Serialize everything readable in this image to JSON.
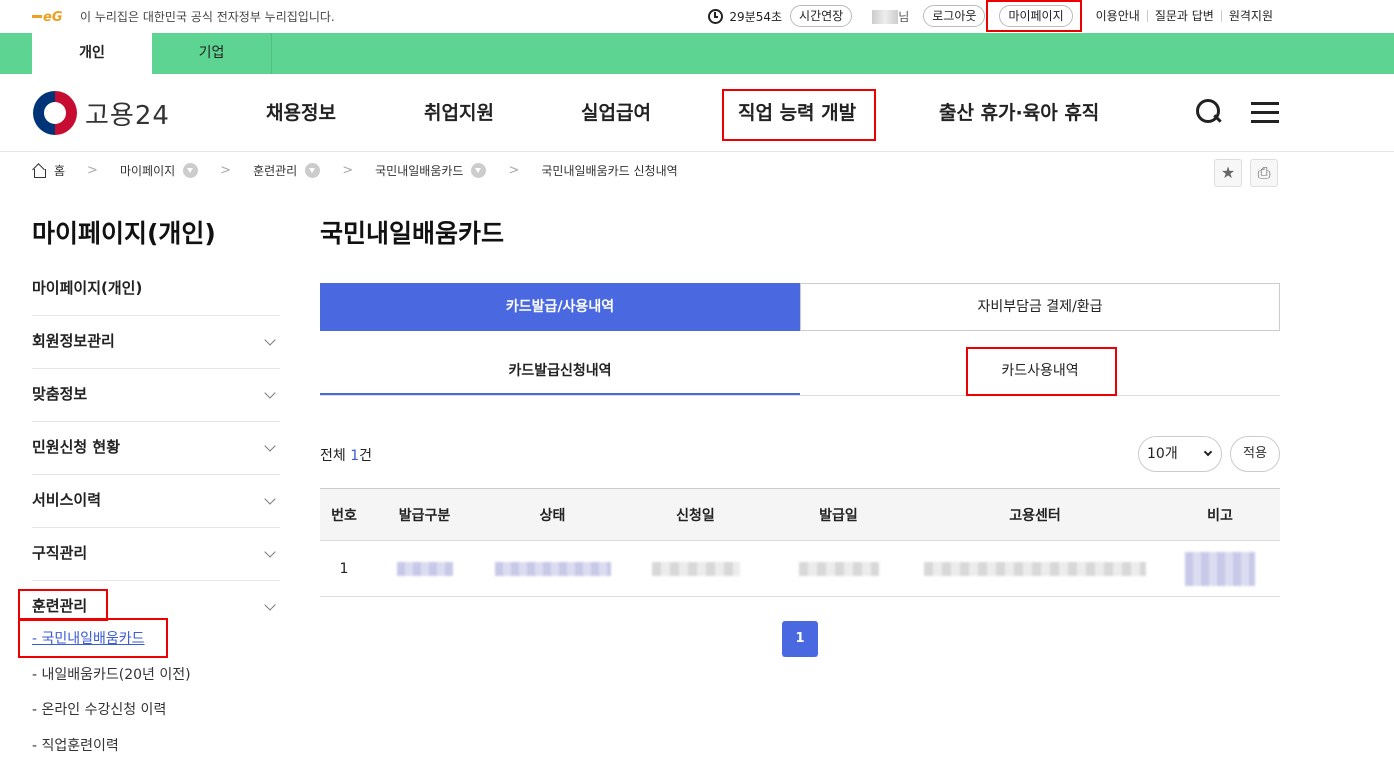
{
  "util": {
    "logo_text": "eG",
    "gov_notice": "이 누리집은 대한민국 공식 전자정부 누리집입니다.",
    "timer": "29분54초",
    "extend_label": "시간연장",
    "user_suffix": "님",
    "logout_label": "로그아웃",
    "mypage_label": "마이페이지",
    "links": [
      "이용안내",
      "질문과 답변",
      "원격지원"
    ]
  },
  "greenbar": {
    "tabs": [
      "개인",
      "기업"
    ]
  },
  "header": {
    "brand": "고용24",
    "nav": [
      "채용정보",
      "취업지원",
      "실업급여",
      "직업 능력 개발",
      "출산 휴가·육아 휴직"
    ]
  },
  "breadcrumb": [
    "홈",
    "마이페이지",
    "훈련관리",
    "국민내일배움카드",
    "국민내일배움카드 신청내역"
  ],
  "lnb": {
    "title": "마이페이지(개인)",
    "items": [
      "마이페이지(개인)",
      "회원정보관리",
      "맞춤정보",
      "민원신청 현황",
      "서비스이력",
      "구직관리",
      "훈련관리"
    ],
    "sub": [
      "- 국민내일배움카드",
      "- 내일배움카드(20년 이전)",
      "- 온라인 수강신청 이력",
      "- 직업훈련이력"
    ]
  },
  "content": {
    "title": "국민내일배움카드",
    "tabs1": [
      "카드발급/사용내역",
      "자비부담금 결제/환급"
    ],
    "tabs2": [
      "카드발급신청내역",
      "카드사용내역"
    ],
    "total_prefix": "전체 ",
    "total_count": "1",
    "total_suffix": "건",
    "page_size": "10개",
    "apply_label": "적용",
    "columns": [
      "번호",
      "발급구분",
      "상태",
      "신청일",
      "발급일",
      "고용센터",
      "비고"
    ],
    "rows": [
      {
        "no": "1"
      }
    ],
    "page": "1"
  },
  "colors": {
    "green": "#5ed493",
    "accent": "#4a68e0",
    "highlight": "#e00000"
  }
}
